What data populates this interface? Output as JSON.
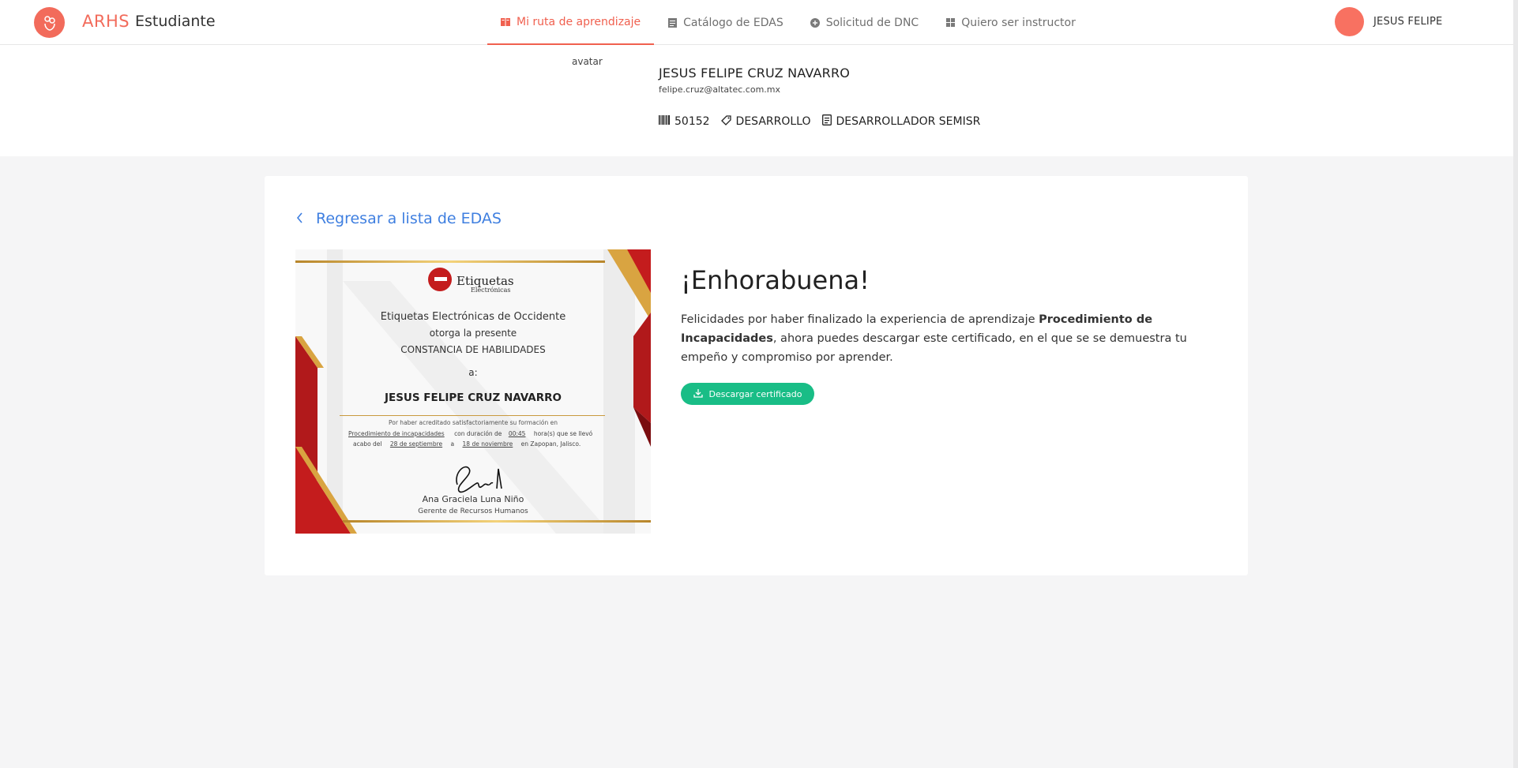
{
  "header": {
    "brand": "ARHS",
    "brand_sub": "Estudiante",
    "nav": [
      {
        "label": "Mi ruta de aprendizaje",
        "icon": "book-icon"
      },
      {
        "label": "Catálogo de EDAS",
        "icon": "list-icon"
      },
      {
        "label": "Solicitud de DNC",
        "icon": "plus-circle-icon"
      },
      {
        "label": "Quiero ser instructor",
        "icon": "grid-icon"
      }
    ],
    "user": "JESUS FELIPE",
    "accent": "#f0604f"
  },
  "profile": {
    "avatar_alt": "avatar",
    "name": "JESUS FELIPE CRUZ NAVARRO",
    "email": "felipe.cruz@altatec.com.mx",
    "employee_id": "50152",
    "area": "DESARROLLO",
    "position": "DESARROLLADOR SEMISR"
  },
  "main": {
    "back_label": "Regresar a lista de EDAS",
    "title": "¡Enhorabuena!",
    "message_prefix": "Felicidades por haber finalizado la experiencia de aprendizaje ",
    "course_name": "Procedimiento de Incapacidades",
    "message_suffix": ", ahora puedes descargar este certificado, en el que se se demuestra tu empeño y compromiso por aprender.",
    "download_label": "Descargar certificado",
    "button_color": "#19bd86"
  },
  "certificate": {
    "logo_text": "Etiquetas",
    "logo_sub": "Electrónicas",
    "company": "Etiquetas Electrónicas de Occidente",
    "grants": "otorga la presente",
    "doc_type": "CONSTANCIA DE HABILIDADES",
    "to": "a:",
    "recipient": "JESUS FELIPE CRUZ NAVARRO",
    "detail_1": "Por haber acreditado satisfactoriamente su formación en",
    "course": "Procedimiento de incapacidades",
    "duration_label": "con duración de",
    "duration": "00:45",
    "hours_label": "hora(s) que se llevó",
    "acabo": "acabo del",
    "start": "28 de septiembre",
    "a": "a",
    "end": "18 de noviembre",
    "place": "en Zapopan, Jalisco.",
    "signer": "Ana Graciela Luna Niño",
    "signer_title": "Gerente de Recursos Humanos"
  }
}
